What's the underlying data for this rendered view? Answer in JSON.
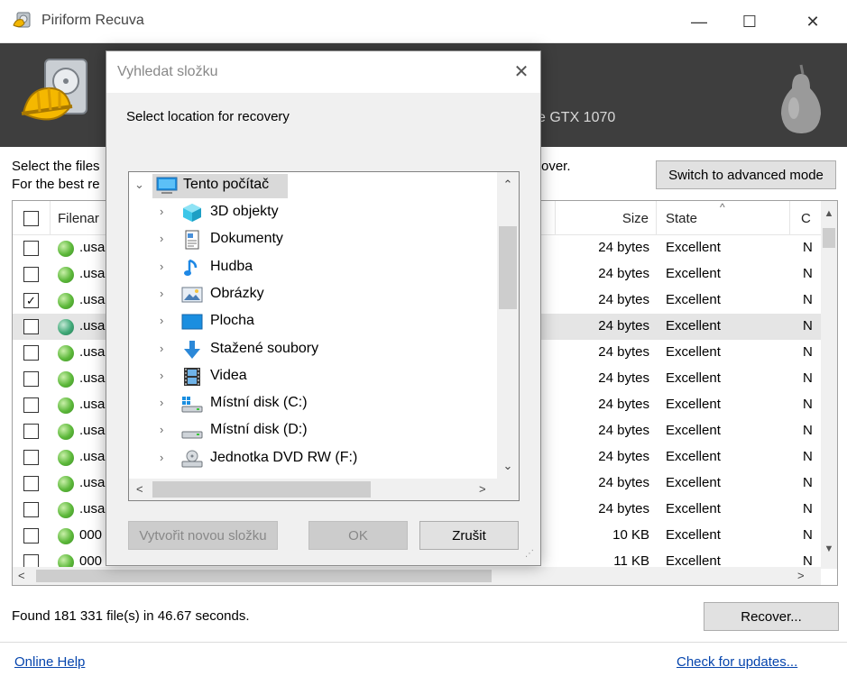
{
  "window": {
    "title": "Piriform Recuva",
    "minimize": "—",
    "maximize": "☐",
    "close": "✕"
  },
  "banner": {
    "hardware_text": "e GTX 1070"
  },
  "instructions": {
    "line1": "Select the files",
    "line2": "For the best re",
    "tail": "over."
  },
  "advanced_button": "Switch to advanced mode",
  "columns": {
    "filename": "Filenar",
    "size": "Size",
    "state": "State",
    "c": "C"
  },
  "files": [
    {
      "name": ".usa",
      "size": "24 bytes",
      "state": "Excellent",
      "c": "N",
      "checked": false,
      "selected": false
    },
    {
      "name": ".usa",
      "size": "24 bytes",
      "state": "Excellent",
      "c": "N",
      "checked": false,
      "selected": false
    },
    {
      "name": ".usa",
      "size": "24 bytes",
      "state": "Excellent",
      "c": "N",
      "checked": true,
      "selected": false
    },
    {
      "name": ".usa",
      "size": "24 bytes",
      "state": "Excellent",
      "c": "N",
      "checked": false,
      "selected": true
    },
    {
      "name": ".usa",
      "size": "24 bytes",
      "state": "Excellent",
      "c": "N",
      "checked": false,
      "selected": false
    },
    {
      "name": ".usa",
      "size": "24 bytes",
      "state": "Excellent",
      "c": "N",
      "checked": false,
      "selected": false
    },
    {
      "name": ".usa",
      "size": "24 bytes",
      "state": "Excellent",
      "c": "N",
      "checked": false,
      "selected": false
    },
    {
      "name": ".usa",
      "size": "24 bytes",
      "state": "Excellent",
      "c": "N",
      "checked": false,
      "selected": false
    },
    {
      "name": ".usa",
      "size": "24 bytes",
      "state": "Excellent",
      "c": "N",
      "checked": false,
      "selected": false
    },
    {
      "name": ".usa",
      "size": "24 bytes",
      "state": "Excellent",
      "c": "N",
      "checked": false,
      "selected": false
    },
    {
      "name": ".usa",
      "size": "24 bytes",
      "state": "Excellent",
      "c": "N",
      "checked": false,
      "selected": false
    },
    {
      "name": "000",
      "size": "10 KB",
      "state": "Excellent",
      "c": "N",
      "checked": false,
      "selected": false
    },
    {
      "name": "000",
      "size": "11 KB",
      "state": "Excellent",
      "c": "N",
      "checked": false,
      "selected": false
    }
  ],
  "status": {
    "found": "Found 181 331 file(s) in 46.67 seconds."
  },
  "recover_button": "Recover...",
  "footer": {
    "online_help": "Online Help",
    "check_updates": "Check for updates..."
  },
  "dialog": {
    "title": "Vyhledat složku",
    "close": "✕",
    "prompt": "Select location for recovery",
    "root": "Tento počítač",
    "items": [
      {
        "label": "3D objekty",
        "icon": "cube-3d-icon"
      },
      {
        "label": "Dokumenty",
        "icon": "document-icon"
      },
      {
        "label": "Hudba",
        "icon": "music-note-icon"
      },
      {
        "label": "Obrázky",
        "icon": "pictures-icon"
      },
      {
        "label": "Plocha",
        "icon": "desktop-icon"
      },
      {
        "label": "Stažené soubory",
        "icon": "download-arrow-icon"
      },
      {
        "label": "Videa",
        "icon": "film-strip-icon"
      },
      {
        "label": "Místní disk (C:)",
        "icon": "windows-drive-icon"
      },
      {
        "label": "Místní disk (D:)",
        "icon": "drive-icon"
      },
      {
        "label": "Jednotka DVD RW (F:)",
        "icon": "dvd-drive-icon"
      }
    ],
    "new_folder_button": "Vytvořit novou složku",
    "ok_button": "OK",
    "cancel_button": "Zrušit"
  }
}
